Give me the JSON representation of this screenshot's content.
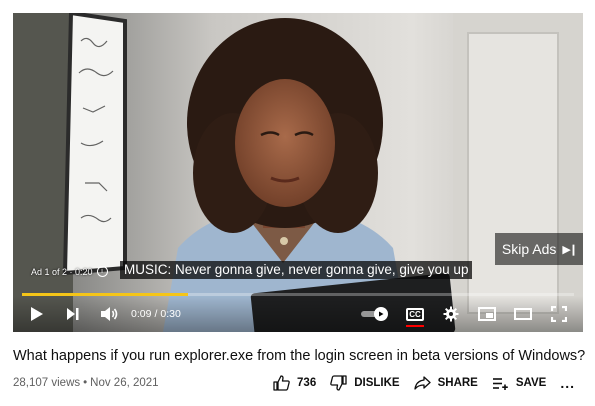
{
  "player": {
    "skip_ads_label": "Skip Ads",
    "ad_counter": "Ad 1 of 2 · 0:20",
    "caption_text": "MUSIC: Never gonna give, never gonna give, give you up",
    "progress_fraction": 0.3,
    "current_time": "0:09",
    "time_separator": "/",
    "total_time": "0:30",
    "progress_color": "#f5c518",
    "icons": [
      "play-icon",
      "next-icon",
      "volume-icon",
      "autoplay-toggle",
      "cc-icon",
      "settings-icon",
      "miniplayer-icon",
      "theater-icon",
      "fullscreen-icon"
    ]
  },
  "video": {
    "title": "What happens if you run explorer.exe from the login screen in beta versions of Windows?",
    "views": "28,107 views",
    "date": "Nov 26, 2021"
  },
  "actions": {
    "like_count": "736",
    "dislike_label": "DISLIKE",
    "share_label": "SHARE",
    "save_label": "SAVE",
    "more_label": "..."
  }
}
